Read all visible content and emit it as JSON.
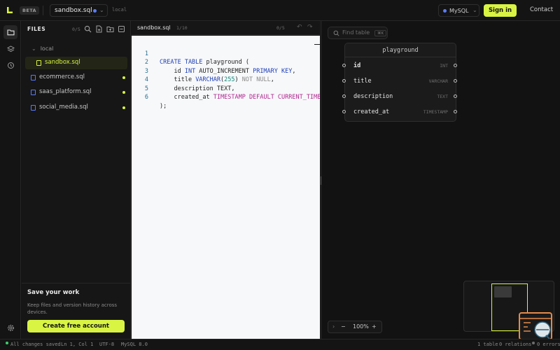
{
  "header": {
    "badge": "BETA",
    "file_name": "sandbox.sql",
    "local_label": "local",
    "database": "MySQL",
    "sign_in": "Sign in",
    "contact": "Contact"
  },
  "sidebar": {
    "title": "FILES",
    "count": "0/5",
    "folder": "local",
    "files": [
      {
        "name": "sandbox.sql",
        "active": true,
        "modified": false
      },
      {
        "name": "ecommerce.sql",
        "active": false,
        "modified": true
      },
      {
        "name": "saas_platform.sql",
        "active": false,
        "modified": true
      },
      {
        "name": "social_media.sql",
        "active": false,
        "modified": true
      }
    ],
    "save_title": "Save your work",
    "save_desc": "Keep files and version history across devices.",
    "create_button": "Create free account"
  },
  "editor": {
    "tab": "sandbox.sql",
    "position": "1/10",
    "errors": "0/5",
    "line_numbers": [
      "1",
      "2",
      "3",
      "4",
      "5",
      "6"
    ],
    "tokens": {
      "l1_a": "CREATE TABLE",
      "l1_b": " playground (",
      "l2_a": "    id ",
      "l2_b": "INT",
      "l2_c": " AUTO_INCREMENT ",
      "l2_d": "PRIMARY KEY",
      "l2_e": ",",
      "l3_a": "    title ",
      "l3_b": "VARCHAR",
      "l3_c": "(",
      "l3_d": "255",
      "l3_e": ") ",
      "l3_f": "NOT NULL",
      "l3_g": ",",
      "l4_a": "    description TEXT,",
      "l5_a": "    created_at ",
      "l5_b": "TIMESTAMP DEFAULT CURRENT_TIMEST",
      "l6_a": ");"
    }
  },
  "canvas": {
    "find_placeholder": "Find table",
    "find_shortcut": "⌘K",
    "table": {
      "name": "playground",
      "columns": [
        {
          "name": "id",
          "type": "INT",
          "primary": true
        },
        {
          "name": "title",
          "type": "VARCHAR",
          "primary": false
        },
        {
          "name": "description",
          "type": "TEXT",
          "primary": false
        },
        {
          "name": "created_at",
          "type": "TIMESTAMP",
          "primary": false
        }
      ]
    },
    "zoom": "100%"
  },
  "status": {
    "saved": "All changes saved",
    "cursor": "Ln 1, Col 1",
    "encoding": "UTF-8",
    "dialect": "MySQL 8.0",
    "tables": "1 table",
    "relations": "0 relations",
    "errors": "0 errors"
  },
  "colors": {
    "accent": "#d9f442",
    "link_dot": "#5b7cf7",
    "success": "#3ecf6e"
  }
}
